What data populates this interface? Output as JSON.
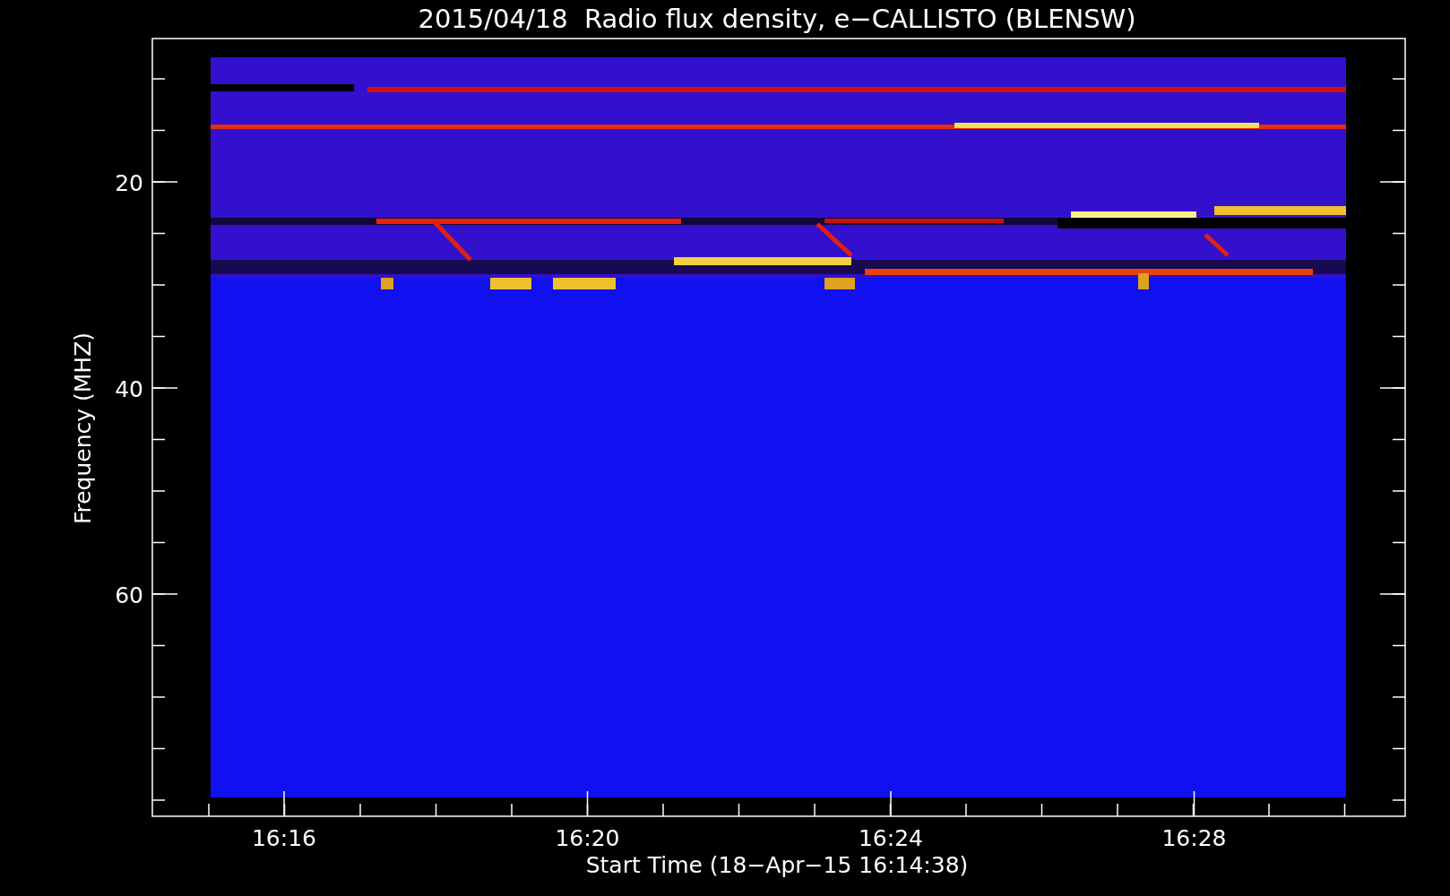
{
  "title": "2015/04/18  Radio flux density, e−CALLISTO (BLENSW)",
  "ylabel": "Frequency (MHZ)",
  "xlabel": "Start Time (18−Apr−15 16:14:38)",
  "yticks": [
    "20",
    "40",
    "60"
  ],
  "xticks": [
    "16:16",
    "16:20",
    "16:24",
    "16:28"
  ]
}
